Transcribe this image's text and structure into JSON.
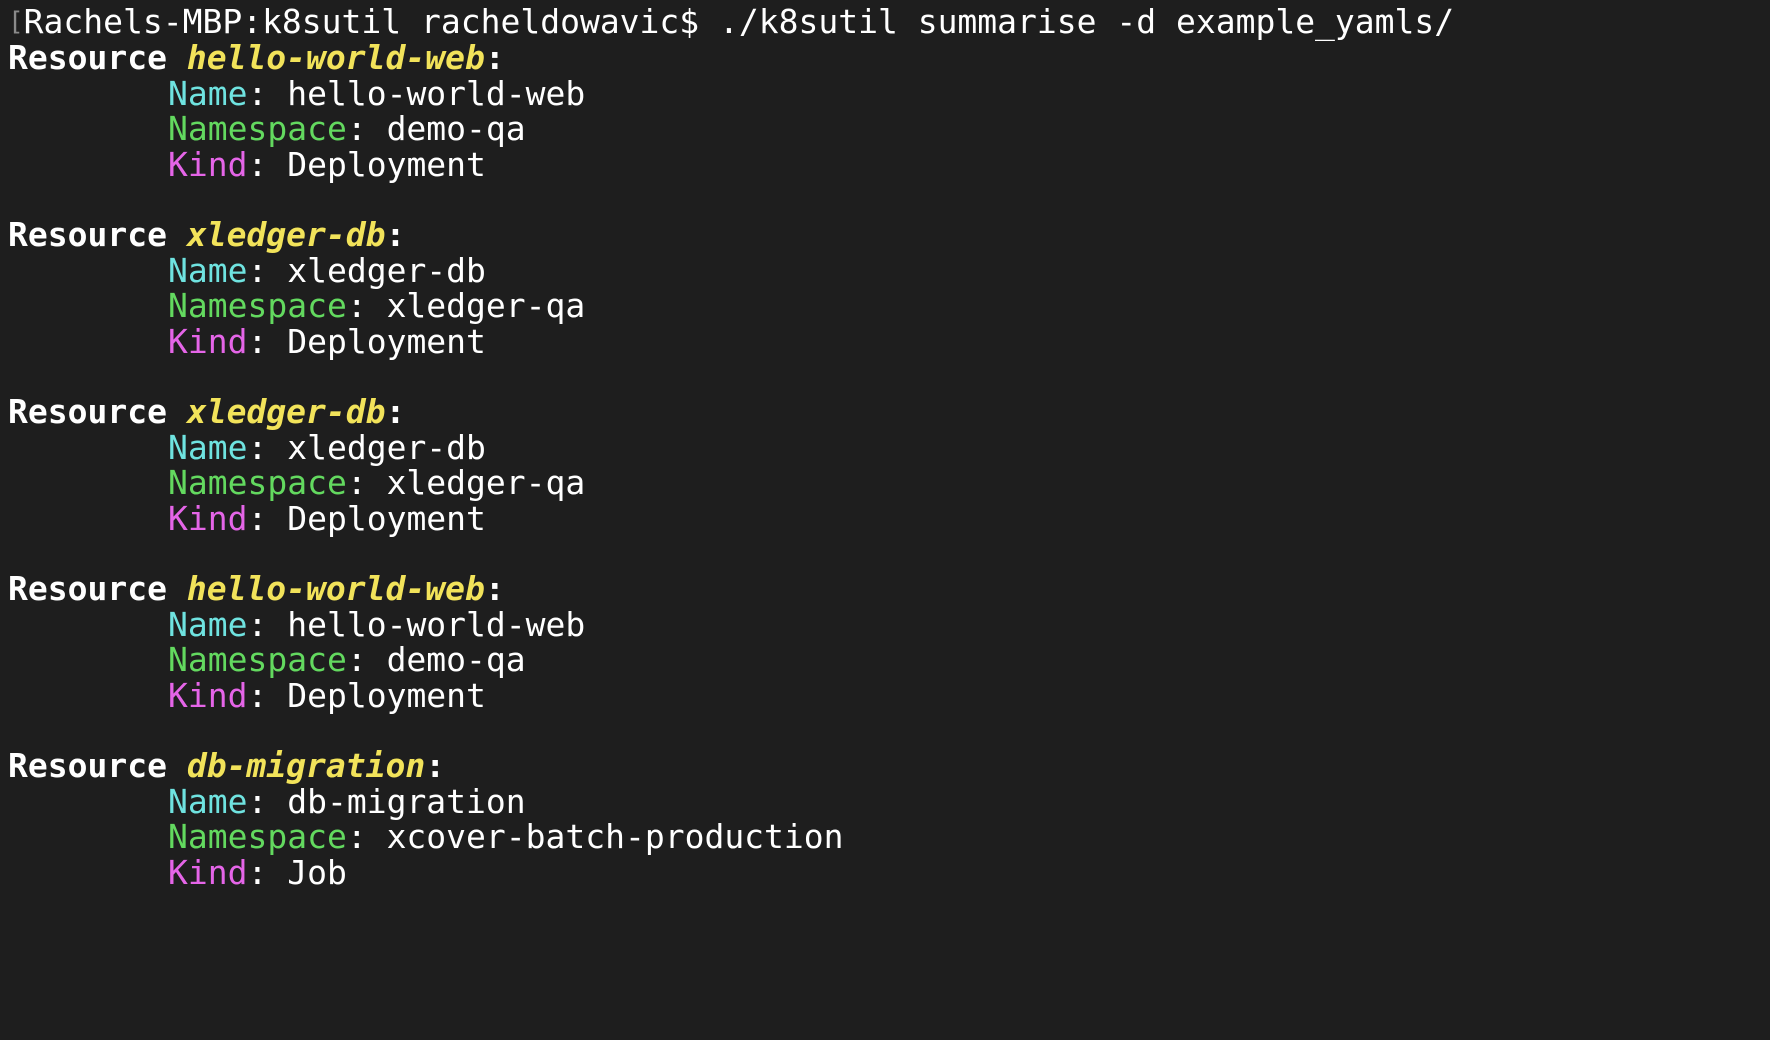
{
  "prompt": {
    "text": "Rachels-MBP:k8sutil racheldowavic$ ./k8sutil summarise -d example_yamls/"
  },
  "labels": {
    "resource": "Resource",
    "colon": ":",
    "name_key": "Name",
    "namespace_key": "Namespace",
    "kind_key": "Kind",
    "sep": ": "
  },
  "resources": [
    {
      "title": "hello-world-web",
      "name": "hello-world-web",
      "namespace": "demo-qa",
      "kind": "Deployment"
    },
    {
      "title": "xledger-db",
      "name": "xledger-db",
      "namespace": "xledger-qa",
      "kind": "Deployment"
    },
    {
      "title": "xledger-db",
      "name": "xledger-db",
      "namespace": "xledger-qa",
      "kind": "Deployment"
    },
    {
      "title": "hello-world-web",
      "name": "hello-world-web",
      "namespace": "demo-qa",
      "kind": "Deployment"
    },
    {
      "title": "db-migration",
      "name": "db-migration",
      "namespace": "xcover-batch-production",
      "kind": "Job"
    }
  ],
  "colors": {
    "background": "#1e1e1e",
    "resource_title": "#f2e35a",
    "name_key": "#6fe3e0",
    "namespace_key": "#63d95f",
    "kind_key": "#e565e8"
  }
}
